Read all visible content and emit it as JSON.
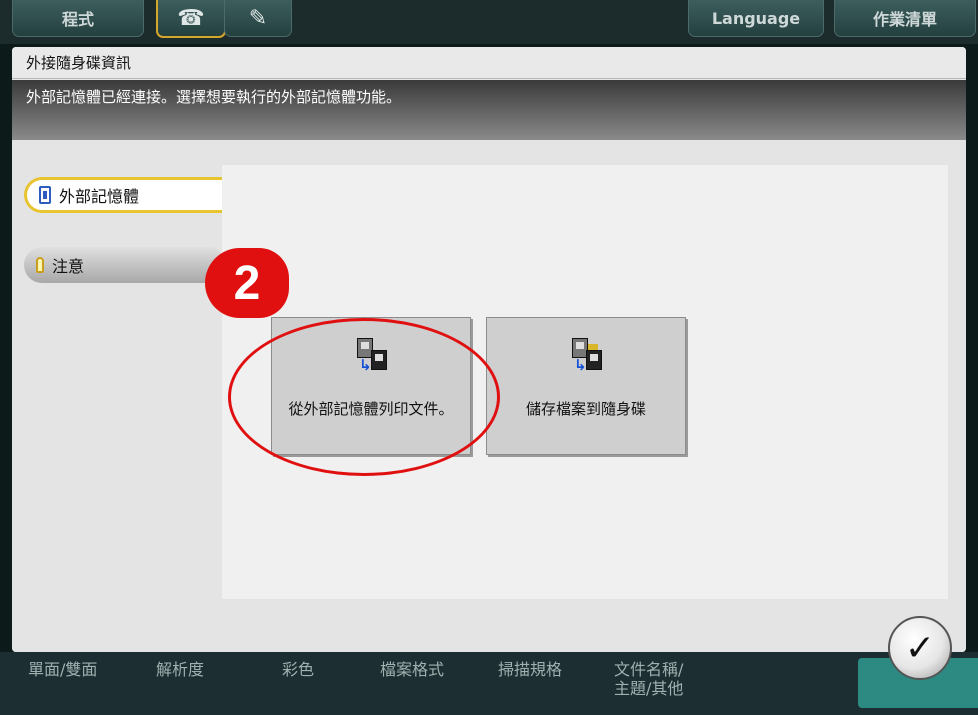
{
  "topbar": {
    "program_label": "程式",
    "phone_icon": "phone-icon",
    "fax_icon": "fax-icon",
    "language_label": "Language",
    "job_list_label": "作業清單"
  },
  "dialog": {
    "title": "外接隨身碟資訊",
    "message": "外部記憶體已經連接。選擇想要執行的外部記憶體功能。"
  },
  "sidebar": {
    "items": [
      {
        "label": "外部記憶體",
        "icon": "usb-icon",
        "active": true
      },
      {
        "label": "注意",
        "icon": "bulb-icon",
        "active": false
      }
    ]
  },
  "functions": [
    {
      "label": "從外部記憶體列印文件。",
      "icon": "print-from-usb-icon"
    },
    {
      "label": "儲存檔案到隨身碟",
      "icon": "save-to-usb-icon"
    }
  ],
  "bottombar": {
    "items": [
      "單面/雙面",
      "解析度",
      "彩色",
      "檔案格式",
      "掃描規格",
      "文件名稱/\n主題/其他"
    ]
  },
  "annotation": {
    "step_number": "2",
    "color": "#e01010"
  },
  "ok_button": {
    "icon": "checkmark-icon",
    "symbol": "✓"
  }
}
